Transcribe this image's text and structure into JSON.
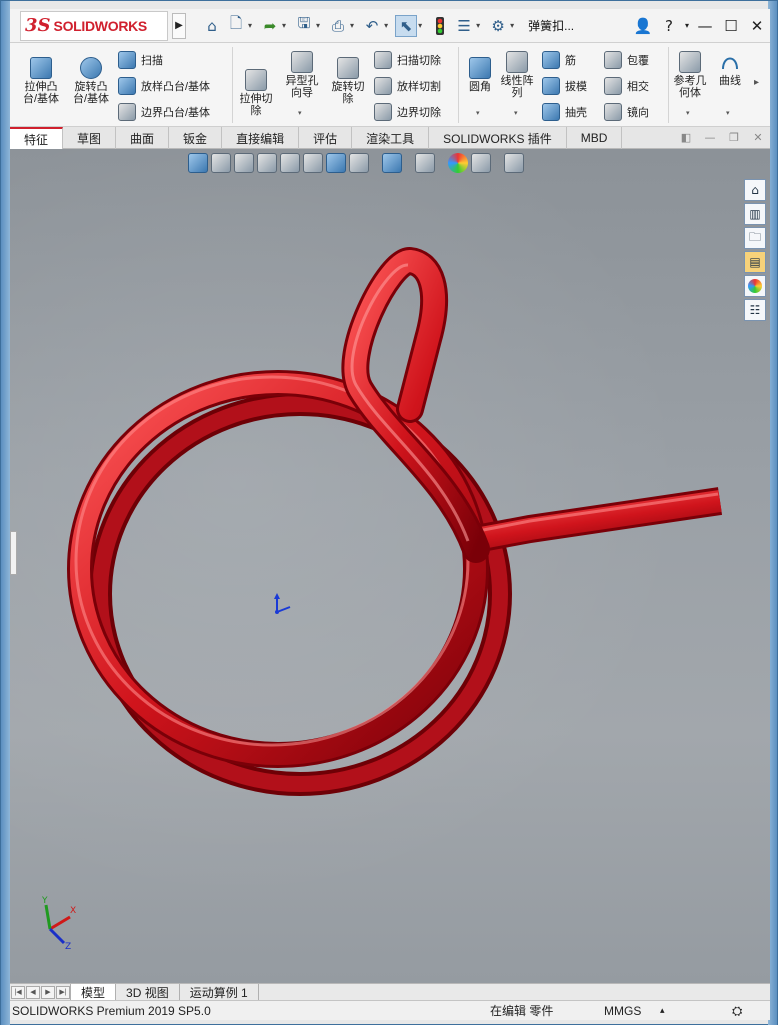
{
  "app": {
    "logo_ds": "3S",
    "logo_word": "SOLIDWORKS",
    "document_title": "弹簧扣...",
    "help": "?"
  },
  "ribbon": {
    "extrude_boss": "拉伸凸台/基体",
    "revolve_boss": "旋转凸台/基体",
    "sweep": "扫描",
    "loft_boss": "放样凸台/基体",
    "boundary_boss": "边界凸台/基体",
    "extrude_cut": "拉伸切除",
    "hole_wizard": "异型孔向导",
    "revolve_cut": "旋转切除",
    "swept_cut": "扫描切除",
    "lofted_cut": "放样切割",
    "boundary_cut": "边界切除",
    "fillet": "圆角",
    "linear_pattern": "线性阵列",
    "rib": "筋",
    "draft": "拔模",
    "shell": "抽壳",
    "wrap": "包覆",
    "intersect": "相交",
    "mirror": "镜向",
    "ref_geometry": "参考几何体",
    "curves": "曲线"
  },
  "tabs": [
    "特征",
    "草图",
    "曲面",
    "钣金",
    "直接编辑",
    "评估",
    "渲染工具",
    "SOLIDWORKS 插件",
    "MBD"
  ],
  "bottom_tabs": [
    "模型",
    "3D 视图",
    "运动算例 1"
  ],
  "status": {
    "product": "SOLIDWORKS Premium 2019 SP5.0",
    "edit_state": "在编辑 零件",
    "units": "MMGS"
  },
  "triad": {
    "x": "X",
    "y": "Y",
    "z": "Z"
  },
  "colors": {
    "accent": "#d0202e",
    "spring": "#c8141c",
    "viewport": "#9aa0a6"
  },
  "icons": {
    "quick_access": [
      "home-icon",
      "new-icon",
      "open-icon",
      "save-icon",
      "print-icon",
      "undo-icon",
      "select-icon",
      "traffic-light-icon",
      "options-list-icon",
      "gear-icon"
    ],
    "right_panel": [
      "home-icon",
      "parts-icon",
      "folder-icon",
      "appearance-icon",
      "color-wheel-icon",
      "list-icon"
    ]
  }
}
